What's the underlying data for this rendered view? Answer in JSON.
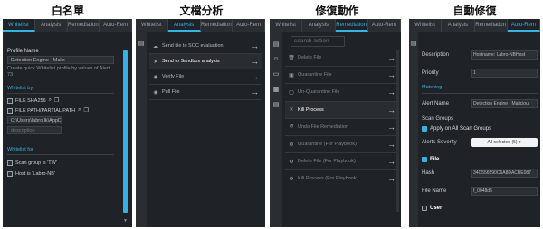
{
  "headings": [
    "白名單",
    "文檔分析",
    "修復動作",
    "自動修復"
  ],
  "panels": [
    {
      "tabs": [
        "Whitelist",
        "Analysis",
        "Remediation",
        "Auto-Rem"
      ],
      "active_tab": 0,
      "profile_name_label": "Profile Name",
      "profile_name_value": "Detection Engine - Malic",
      "profile_note": "Create quick Whitelist profile by values of Alert 73",
      "whitelist_by_label": "Whitelist by",
      "items": [
        "FILE SHA256",
        "FILE PATH/PARTIAL PATH"
      ],
      "path_value": "C:\\Users\\labro.lk\\AppD",
      "description_placeholder": "description",
      "whitelist_for_label": "Whitelist for",
      "for_items": [
        "Scan group is 'TW'",
        "Host is 'Labro-NB'"
      ]
    },
    {
      "tabs": [
        "Whitelist",
        "Analysis",
        "Remediation",
        "Auto-Rem"
      ],
      "active_tab": 1,
      "actions": [
        {
          "label": "Send file to SOC evaluation",
          "selected": false
        },
        {
          "label": "Send to Sandbox analysis",
          "selected": true
        },
        {
          "label": "Verify File",
          "selected": false
        },
        {
          "label": "Pull File",
          "selected": false
        }
      ]
    },
    {
      "tabs": [
        "Whitelist",
        "Analysis",
        "Remediation",
        "Auto-Rem"
      ],
      "active_tab": 2,
      "search_placeholder": "search action",
      "actions": [
        {
          "label": "Delete File",
          "dim": true
        },
        {
          "label": "Quarantine File",
          "dim": true
        },
        {
          "label": "Un-Quarantine File",
          "dim": true
        },
        {
          "label": "Kill Process",
          "dim": false
        },
        {
          "label": "Undo File Remediation",
          "dim": true
        },
        {
          "label": "Quarantine (For Playbook)",
          "dim": true
        },
        {
          "label": "Delete File (For Playbook)",
          "dim": true
        },
        {
          "label": "Kill Process (For Playbook)",
          "dim": true
        }
      ]
    },
    {
      "tabs": [
        "Whitelist",
        "Analysis",
        "Remediation",
        "Auto-Rem"
      ],
      "active_tab": 3,
      "description_label": "Description",
      "description_value": "Hostname: Labro-NBHost",
      "priority_label": "Priority",
      "priority_value": "1",
      "matching_label": "Matching",
      "alert_name_label": "Alert Name",
      "alert_name_value": "Detection Engine - Maliciou",
      "scan_groups_label": "Scan Groups",
      "apply_all_label": "Apply on All Scan Groups",
      "alerts_severity_label": "Alerts Severity",
      "alerts_severity_value": "All selected (5) ▾",
      "file_label": "File",
      "hash_label": "Hash",
      "hash_value": "34C556590C6A8DACBE087",
      "file_name_label": "File Name",
      "file_name_value": "f_0048d5",
      "user_label": "User"
    }
  ],
  "colors": {
    "accent": "#34b3e4",
    "panel_bg": "#1f2226"
  }
}
